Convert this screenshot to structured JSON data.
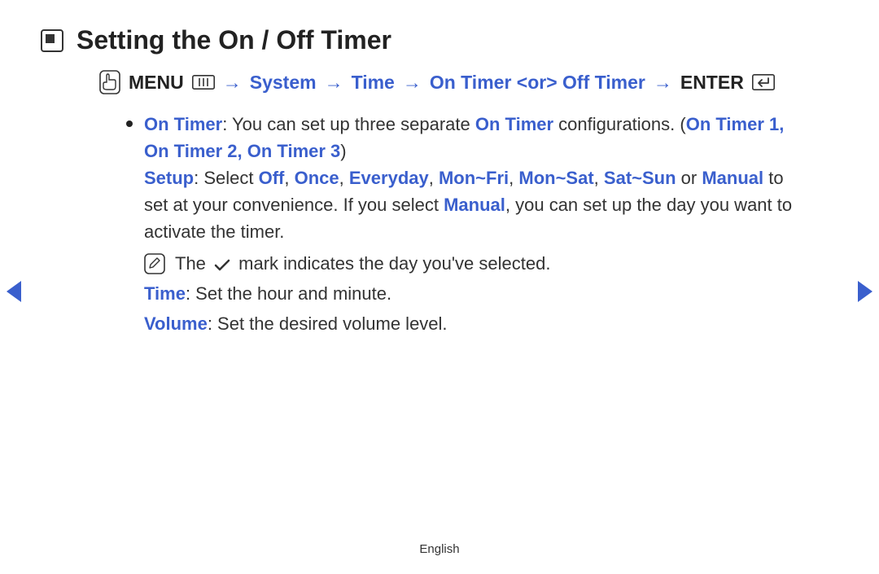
{
  "title": "Setting the On / Off Timer",
  "breadcrumb": {
    "menu": "MENU",
    "path1": "System",
    "path2": "Time",
    "path3": "On Timer <or> Off Timer",
    "enter": "ENTER",
    "arrow": "→"
  },
  "body": {
    "onTimerLabel": "On Timer",
    "onTimerDesc1": ": You can set up three separate ",
    "onTimerRef": "On Timer",
    "onTimerDesc2": " configurations. (",
    "onTimer1": "On Timer 1",
    "onTimer2": "On Timer 2",
    "onTimer3": "On Timer 3",
    "comma": ", ",
    "closeParen": ")",
    "setupLabel": "Setup",
    "setupDesc1": ": Select ",
    "off": "Off",
    "once": "Once",
    "everyday": "Everyday",
    "monfri": "Mon~Fri",
    "monsat": "Mon~Sat",
    "satsun": "Sat~Sun",
    "or": " or ",
    "manual": "Manual",
    "setupDesc2": " to set at your convenience. If you select ",
    "manual2": "Manual",
    "setupDesc3": ", you can set up the day you want to activate the timer.",
    "noteThe": "The ",
    "noteRest": " mark indicates the day you've selected.",
    "timeLabel": "Time",
    "timeDesc": ": Set the hour and minute.",
    "volumeLabel": "Volume",
    "volumeDesc": ": Set the desired volume level."
  },
  "footer": "English"
}
